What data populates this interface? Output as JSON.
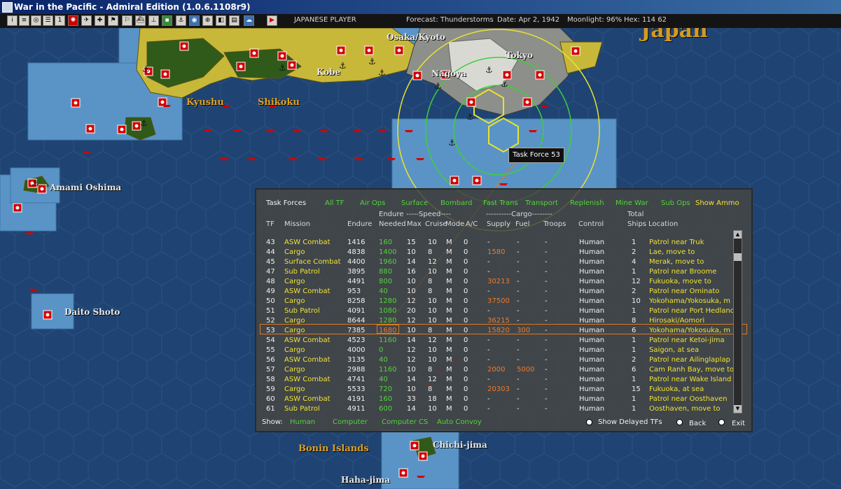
{
  "window": {
    "title": "War in the Pacific - Admiral Edition (1.0.6.1108r9)"
  },
  "toolbar": {
    "player": "JAPANESE PLAYER",
    "forecast": "Forecast: Thunderstorms",
    "date": "Date: Apr 2, 1942",
    "moonlight": "Moonlight: 96%",
    "hex": "Hex: 114 62"
  },
  "map": {
    "labels": [
      "Japan",
      "Osaka/Kyoto",
      "Tokyo",
      "Kobe",
      "Nagoya",
      "Kyushu",
      "Shikoku",
      "Amami Oshima",
      "Daito Shoto",
      "Bonin Islands",
      "Chichi-jima",
      "Haha-jima"
    ],
    "tooltip": "Task Force 53"
  },
  "panel": {
    "title": "Task Forces",
    "filters": [
      "All TF",
      "Air Ops",
      "Surface",
      "Bombard",
      "Fast Trans",
      "Transport",
      "Replenish",
      "Mine War",
      "Sub Ops",
      "Show Ammo"
    ],
    "group_headers": {
      "endure": "Endure",
      "speed": "-----Speed----",
      "cargo": "----------Cargo--------",
      "total": "Total"
    },
    "columns": {
      "tf": "TF",
      "mission": "Mission",
      "endure": "Endure",
      "needed": "Needed",
      "max": "Max",
      "cruise": "Cruise",
      "mode": "Mode",
      "ac": "A/C",
      "supply": "Supply",
      "fuel": "Fuel",
      "troops": "Troops",
      "control": "Control",
      "ships": "Ships",
      "location": "Location"
    },
    "rows": [
      {
        "tf": "43",
        "mission": "ASW Combat",
        "endure": "1416",
        "needed": "160",
        "max": "15",
        "cruise": "10",
        "mode": "M",
        "ac": "0",
        "supply": "-",
        "fuel": "-",
        "troops": "-",
        "control": "Human",
        "ships": "1",
        "location": "Patrol near Truk"
      },
      {
        "tf": "44",
        "mission": "Cargo",
        "endure": "4838",
        "needed": "1400",
        "max": "10",
        "cruise": "8",
        "mode": "M",
        "ac": "0",
        "supply": "1580",
        "fuel": "-",
        "troops": "-",
        "control": "Human",
        "ships": "2",
        "location": "Lae, move to"
      },
      {
        "tf": "45",
        "mission": "Surface Combat",
        "endure": "4400",
        "needed": "1960",
        "max": "14",
        "cruise": "12",
        "mode": "M",
        "ac": "0",
        "supply": "-",
        "fuel": "-",
        "troops": "-",
        "control": "Human",
        "ships": "4",
        "location": "Merak, move to"
      },
      {
        "tf": "47",
        "mission": "Sub Patrol",
        "endure": "3895",
        "needed": "880",
        "max": "16",
        "cruise": "10",
        "mode": "M",
        "ac": "0",
        "supply": "-",
        "fuel": "-",
        "troops": "-",
        "control": "Human",
        "ships": "1",
        "location": "Patrol near Broome"
      },
      {
        "tf": "48",
        "mission": "Cargo",
        "endure": "4491",
        "needed": "800",
        "max": "10",
        "cruise": "8",
        "mode": "M",
        "ac": "0",
        "supply": "30213",
        "fuel": "-",
        "troops": "-",
        "control": "Human",
        "ships": "12",
        "location": "Fukuoka, move to"
      },
      {
        "tf": "49",
        "mission": "ASW Combat",
        "endure": "953",
        "needed": "40",
        "max": "10",
        "cruise": "8",
        "mode": "M",
        "ac": "0",
        "supply": "-",
        "fuel": "-",
        "troops": "-",
        "control": "Human",
        "ships": "2",
        "location": "Patrol near Ominato"
      },
      {
        "tf": "50",
        "mission": "Cargo",
        "endure": "8258",
        "needed": "1280",
        "max": "12",
        "cruise": "10",
        "mode": "M",
        "ac": "0",
        "supply": "37500",
        "fuel": "-",
        "troops": "-",
        "control": "Human",
        "ships": "10",
        "location": "Yokohama/Yokosuka, m"
      },
      {
        "tf": "51",
        "mission": "Sub Patrol",
        "endure": "4091",
        "needed": "1080",
        "max": "20",
        "cruise": "10",
        "mode": "M",
        "ac": "0",
        "supply": "-",
        "fuel": "-",
        "troops": "-",
        "control": "Human",
        "ships": "1",
        "location": "Patrol near Port Hedland"
      },
      {
        "tf": "52",
        "mission": "Cargo",
        "endure": "8644",
        "needed": "1280",
        "max": "12",
        "cruise": "10",
        "mode": "M",
        "ac": "0",
        "supply": "36215",
        "fuel": "-",
        "troops": "-",
        "control": "Human",
        "ships": "8",
        "location": "Hirosaki/Aomori"
      },
      {
        "tf": "53",
        "mission": "Cargo",
        "endure": "7385",
        "needed": "1680",
        "max": "10",
        "cruise": "8",
        "mode": "M",
        "ac": "0",
        "supply": "15820",
        "fuel": "300",
        "troops": "-",
        "control": "Human",
        "ships": "6",
        "location": "Yokohama/Yokosuka, m"
      },
      {
        "tf": "54",
        "mission": "ASW Combat",
        "endure": "4523",
        "needed": "1160",
        "max": "14",
        "cruise": "12",
        "mode": "M",
        "ac": "0",
        "supply": "-",
        "fuel": "-",
        "troops": "-",
        "control": "Human",
        "ships": "1",
        "location": "Patrol near Ketoi-jima"
      },
      {
        "tf": "55",
        "mission": "Cargo",
        "endure": "4000",
        "needed": "0",
        "max": "12",
        "cruise": "10",
        "mode": "M",
        "ac": "0",
        "supply": "-",
        "fuel": "-",
        "troops": "-",
        "control": "Human",
        "ships": "1",
        "location": "Saigon, at sea"
      },
      {
        "tf": "56",
        "mission": "ASW Combat",
        "endure": "3135",
        "needed": "40",
        "max": "12",
        "cruise": "10",
        "mode": "M",
        "ac": "0",
        "supply": "-",
        "fuel": "-",
        "troops": "-",
        "control": "Human",
        "ships": "2",
        "location": "Patrol near Ailinglaplap"
      },
      {
        "tf": "57",
        "mission": "Cargo",
        "endure": "2988",
        "needed": "1160",
        "max": "10",
        "cruise": "8",
        "mode": "M",
        "ac": "0",
        "supply": "2000",
        "fuel": "5000",
        "troops": "-",
        "control": "Human",
        "ships": "6",
        "location": "Cam Ranh Bay, move to"
      },
      {
        "tf": "58",
        "mission": "ASW Combat",
        "endure": "4741",
        "needed": "40",
        "max": "14",
        "cruise": "12",
        "mode": "M",
        "ac": "0",
        "supply": "-",
        "fuel": "-",
        "troops": "-",
        "control": "Human",
        "ships": "1",
        "location": "Patrol near Wake Island"
      },
      {
        "tf": "59",
        "mission": "Cargo",
        "endure": "5533",
        "needed": "720",
        "max": "10",
        "cruise": "8",
        "mode": "M",
        "ac": "0",
        "supply": "20303",
        "fuel": "-",
        "troops": "-",
        "control": "Human",
        "ships": "15",
        "location": "Fukuoka, at sea"
      },
      {
        "tf": "60",
        "mission": "ASW Combat",
        "endure": "4191",
        "needed": "160",
        "max": "33",
        "cruise": "18",
        "mode": "M",
        "ac": "0",
        "supply": "-",
        "fuel": "-",
        "troops": "-",
        "control": "Human",
        "ships": "1",
        "location": "Patrol near Oosthaven"
      },
      {
        "tf": "61",
        "mission": "Sub Patrol",
        "endure": "4911",
        "needed": "600",
        "max": "14",
        "cruise": "10",
        "mode": "M",
        "ac": "0",
        "supply": "-",
        "fuel": "-",
        "troops": "-",
        "control": "Human",
        "ships": "1",
        "location": "Oosthaven, move to"
      }
    ],
    "show": {
      "label": "Show:",
      "options": [
        "Human",
        "Computer",
        "Computer CS",
        "Auto Convoy"
      ]
    },
    "buttons": {
      "delayed": "Show Delayed TFs",
      "back": "Back",
      "exit": "Exit"
    }
  },
  "colors": {
    "highlight": "#e0781e",
    "filter_text": "#52d43a",
    "mission_text": "#f0e236",
    "cargo_amount": "#ee7a2c"
  }
}
